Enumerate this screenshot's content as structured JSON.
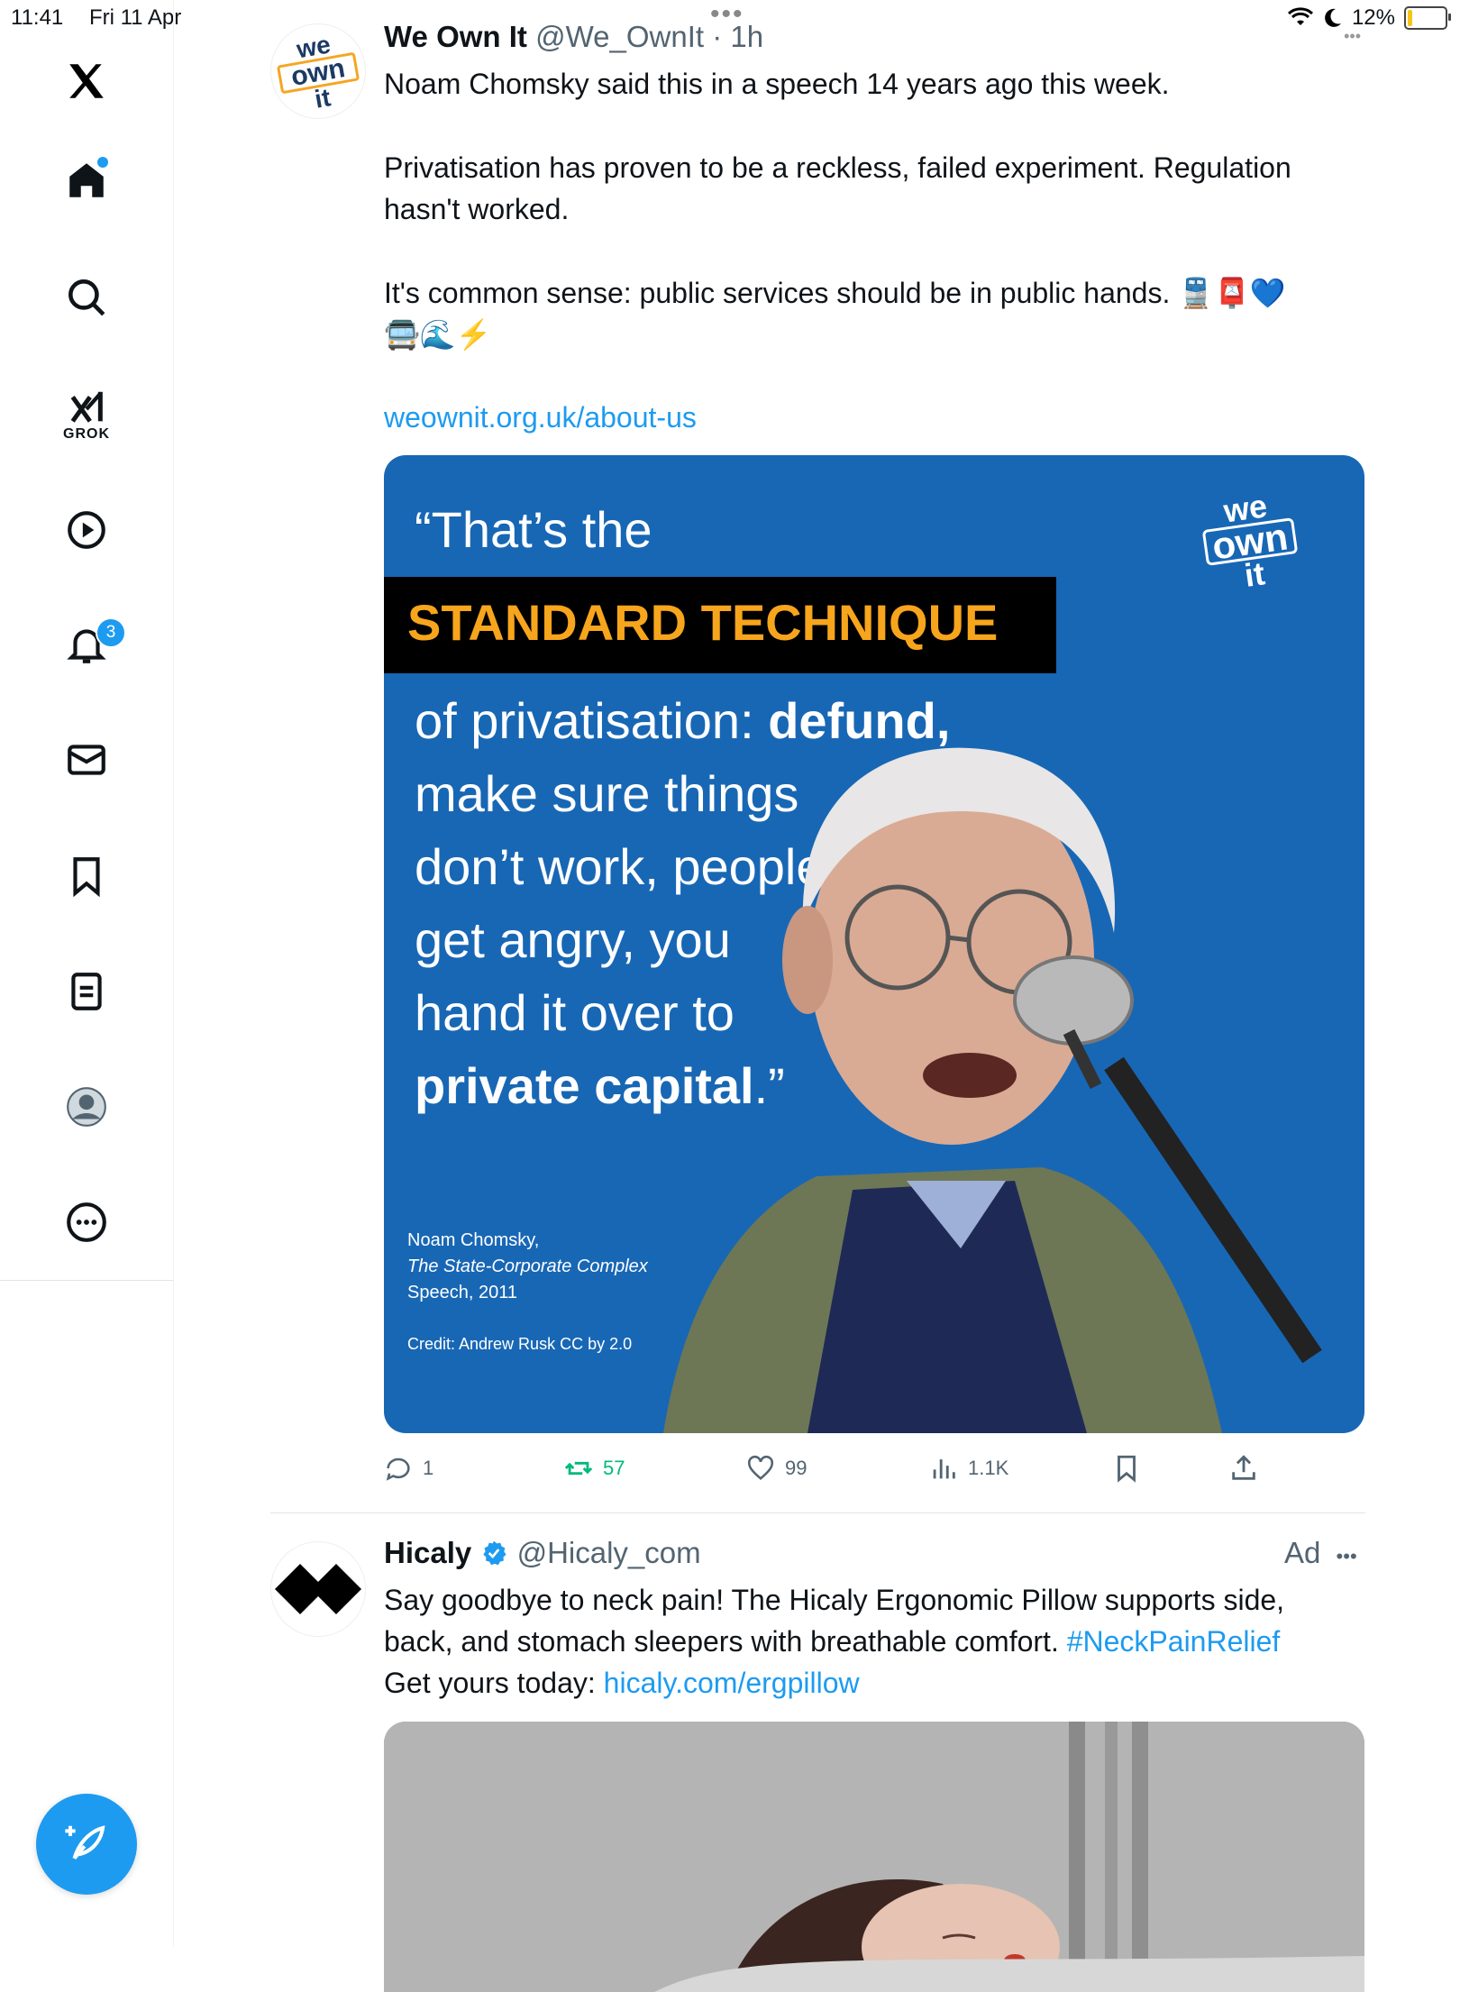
{
  "status": {
    "time": "11:41",
    "date": "Fri 11 Apr",
    "battery": "12%",
    "battery_level": 0.12
  },
  "sidebar": {
    "grok_label": "GROK",
    "notifications_count": "3"
  },
  "tweet1": {
    "name": "We Own It",
    "handle": "@We_OwnIt",
    "sep": "·",
    "time": "1h",
    "avatar_text": [
      "we",
      "own",
      "it"
    ],
    "text_line1": "Noam Chomsky said this in a speech 14 years ago this week.",
    "text_line2": "Privatisation has proven to be a reckless, failed experiment. Regulation hasn't worked.",
    "text_line3": "It's common sense: public services should be in public hands. 🚆📮💙",
    "text_line4": "🚍🌊⚡",
    "link": "weownit.org.uk/about-us",
    "image": {
      "line1": "“That’s the",
      "band": "STANDARD TECHNIQUE",
      "line3a": "of privatisation: ",
      "line3b": "defund,",
      "line4": "make sure things",
      "line5": "don’t work, people",
      "line6": "get angry, you",
      "line7": "hand it over to",
      "line8a": "private capital",
      "line8b": ".”",
      "credit1": "Noam Chomsky,",
      "credit2": "The State-Corporate Complex",
      "credit3": "Speech, 2011",
      "credit4": "Credit: Andrew Rusk CC by 2.0",
      "logo": [
        "we",
        "own",
        "it"
      ]
    },
    "replies": "1",
    "retweets": "57",
    "likes": "99",
    "views": "1.1K"
  },
  "tweet2": {
    "name": "Hicaly",
    "handle": "@Hicaly_com",
    "ad_label": "Ad",
    "text_a": "Say goodbye to neck pain! The Hicaly Ergonomic Pillow supports side, back, and stomach sleepers with breathable comfort. ",
    "hashtag": "#NeckPainRelief",
    "text_b": "Get yours today: ",
    "link": "hicaly.com/ergpillow"
  },
  "colors": {
    "accent": "#1d9bf0",
    "retweet": "#00ba7c",
    "quote_bg": "#1867b5",
    "quote_highlight": "#f7a51c"
  }
}
